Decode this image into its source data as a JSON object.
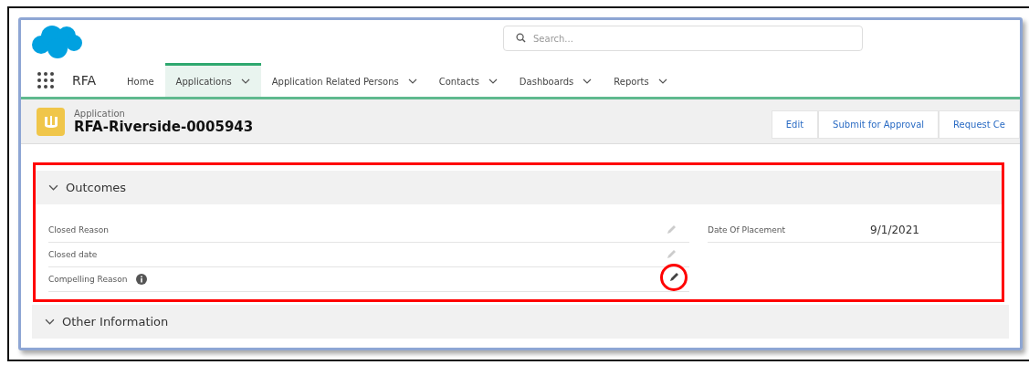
{
  "search": {
    "placeholder": "Search..."
  },
  "app_name": "RFA",
  "nav": [
    {
      "label": "Home",
      "dropdown": false,
      "selected": false
    },
    {
      "label": "Applications",
      "dropdown": true,
      "selected": true
    },
    {
      "label": "Application Related Persons",
      "dropdown": true,
      "selected": false
    },
    {
      "label": "Contacts",
      "dropdown": true,
      "selected": false
    },
    {
      "label": "Dashboards",
      "dropdown": true,
      "selected": false
    },
    {
      "label": "Reports",
      "dropdown": true,
      "selected": false
    }
  ],
  "record": {
    "object": "Application",
    "name": "RFA-Riverside-0005943"
  },
  "actions": [
    "Edit",
    "Submit for Approval",
    "Request Ce"
  ],
  "sections": [
    {
      "title": "Outcomes",
      "expanded": true,
      "highlighted": true,
      "left_fields": [
        {
          "label": "Closed Reason",
          "info": false,
          "hovered": false,
          "circled": false
        },
        {
          "label": "Closed date",
          "info": false,
          "hovered": false,
          "circled": false
        },
        {
          "label": "Compelling Reason",
          "info": true,
          "hovered": true,
          "circled": true
        }
      ],
      "right_fields": [
        {
          "label": "Date Of Placement",
          "value": "9/1/2021"
        }
      ]
    },
    {
      "title": "Other Information",
      "expanded": true,
      "highlighted": false
    }
  ]
}
